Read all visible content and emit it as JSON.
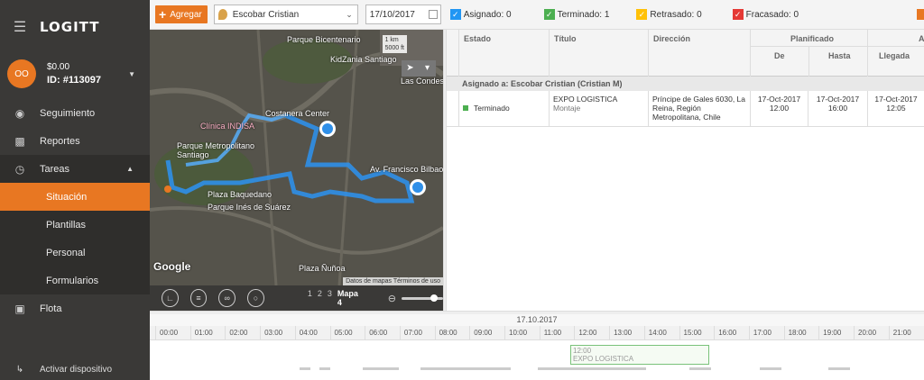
{
  "sidebar": {
    "logo": "LOGITT",
    "account": {
      "initials": "OO",
      "balance": "$0.00",
      "id": "ID: #113097"
    },
    "items": [
      {
        "label": "Seguimiento",
        "icon": "globe-icon"
      },
      {
        "label": "Reportes",
        "icon": "chart-icon"
      },
      {
        "label": "Tareas",
        "icon": "clock-icon"
      },
      {
        "label": "Situación"
      },
      {
        "label": "Plantillas"
      },
      {
        "label": "Personal"
      },
      {
        "label": "Formularios"
      },
      {
        "label": "Flota",
        "icon": "car-icon"
      }
    ],
    "bottom": "Activar dispositivo"
  },
  "toolbar": {
    "add_label": "Agregar",
    "driver": "Escobar Cristian",
    "date": "17/10/2017",
    "statuses": [
      {
        "label": "Asignado: 0",
        "color": "#2196f3"
      },
      {
        "label": "Terminado: 1",
        "color": "#4caf50"
      },
      {
        "label": "Retrasado: 0",
        "color": "#ffc107"
      },
      {
        "label": "Fracasado: 0",
        "color": "#e53935"
      }
    ]
  },
  "map": {
    "scale_km": "1 km",
    "scale_ft": "5000 ft",
    "labels": [
      "Parque Bicentenario",
      "KidZania Santiago",
      "Costanera Center",
      "Clínica INDISA",
      "Parque Metropolitano Santiago",
      "Plaza Baquedano",
      "Parque Inés de Suárez",
      "Plaza Ñuñoa",
      "Las Condes",
      "Av. Francisco Bilbao"
    ],
    "google": "Google",
    "terms": "Datos de mapas   Términos de uso",
    "pages": [
      "1",
      "2",
      "3"
    ],
    "current_page": "Mapa 4"
  },
  "table": {
    "headers": {
      "estado": "Estado",
      "titulo": "Título",
      "direccion": "Dirección",
      "planificado": "Planificado",
      "de": "De",
      "hasta": "Hasta",
      "a": "A",
      "llegada": "Llegada"
    },
    "group": "Asignado a: Escobar Cristian (Cristian M)",
    "rows": [
      {
        "estado": "Terminado",
        "titulo": "EXPO LOGISTICA",
        "subtitulo": "Montaje",
        "direccion": "Príncipe de Gales 6030, La Reina, Región Metropolitana, Chile",
        "de_date": "17-Oct-2017",
        "de_time": "12:00",
        "hasta_date": "17-Oct-2017",
        "hasta_time": "16:00",
        "llegada_date": "17-Oct-2017",
        "llegada_time": "12:05"
      }
    ]
  },
  "timeline": {
    "date": "17.10.2017",
    "hours": [
      "00:00",
      "01:00",
      "02:00",
      "03:00",
      "04:00",
      "05:00",
      "06:00",
      "07:00",
      "08:00",
      "09:00",
      "10:00",
      "11:00",
      "12:00",
      "13:00",
      "14:00",
      "15:00",
      "16:00",
      "17:00",
      "18:00",
      "19:00",
      "20:00",
      "21:00"
    ],
    "event_time": "12:00",
    "event_title": "EXPO LOGISTICA"
  }
}
